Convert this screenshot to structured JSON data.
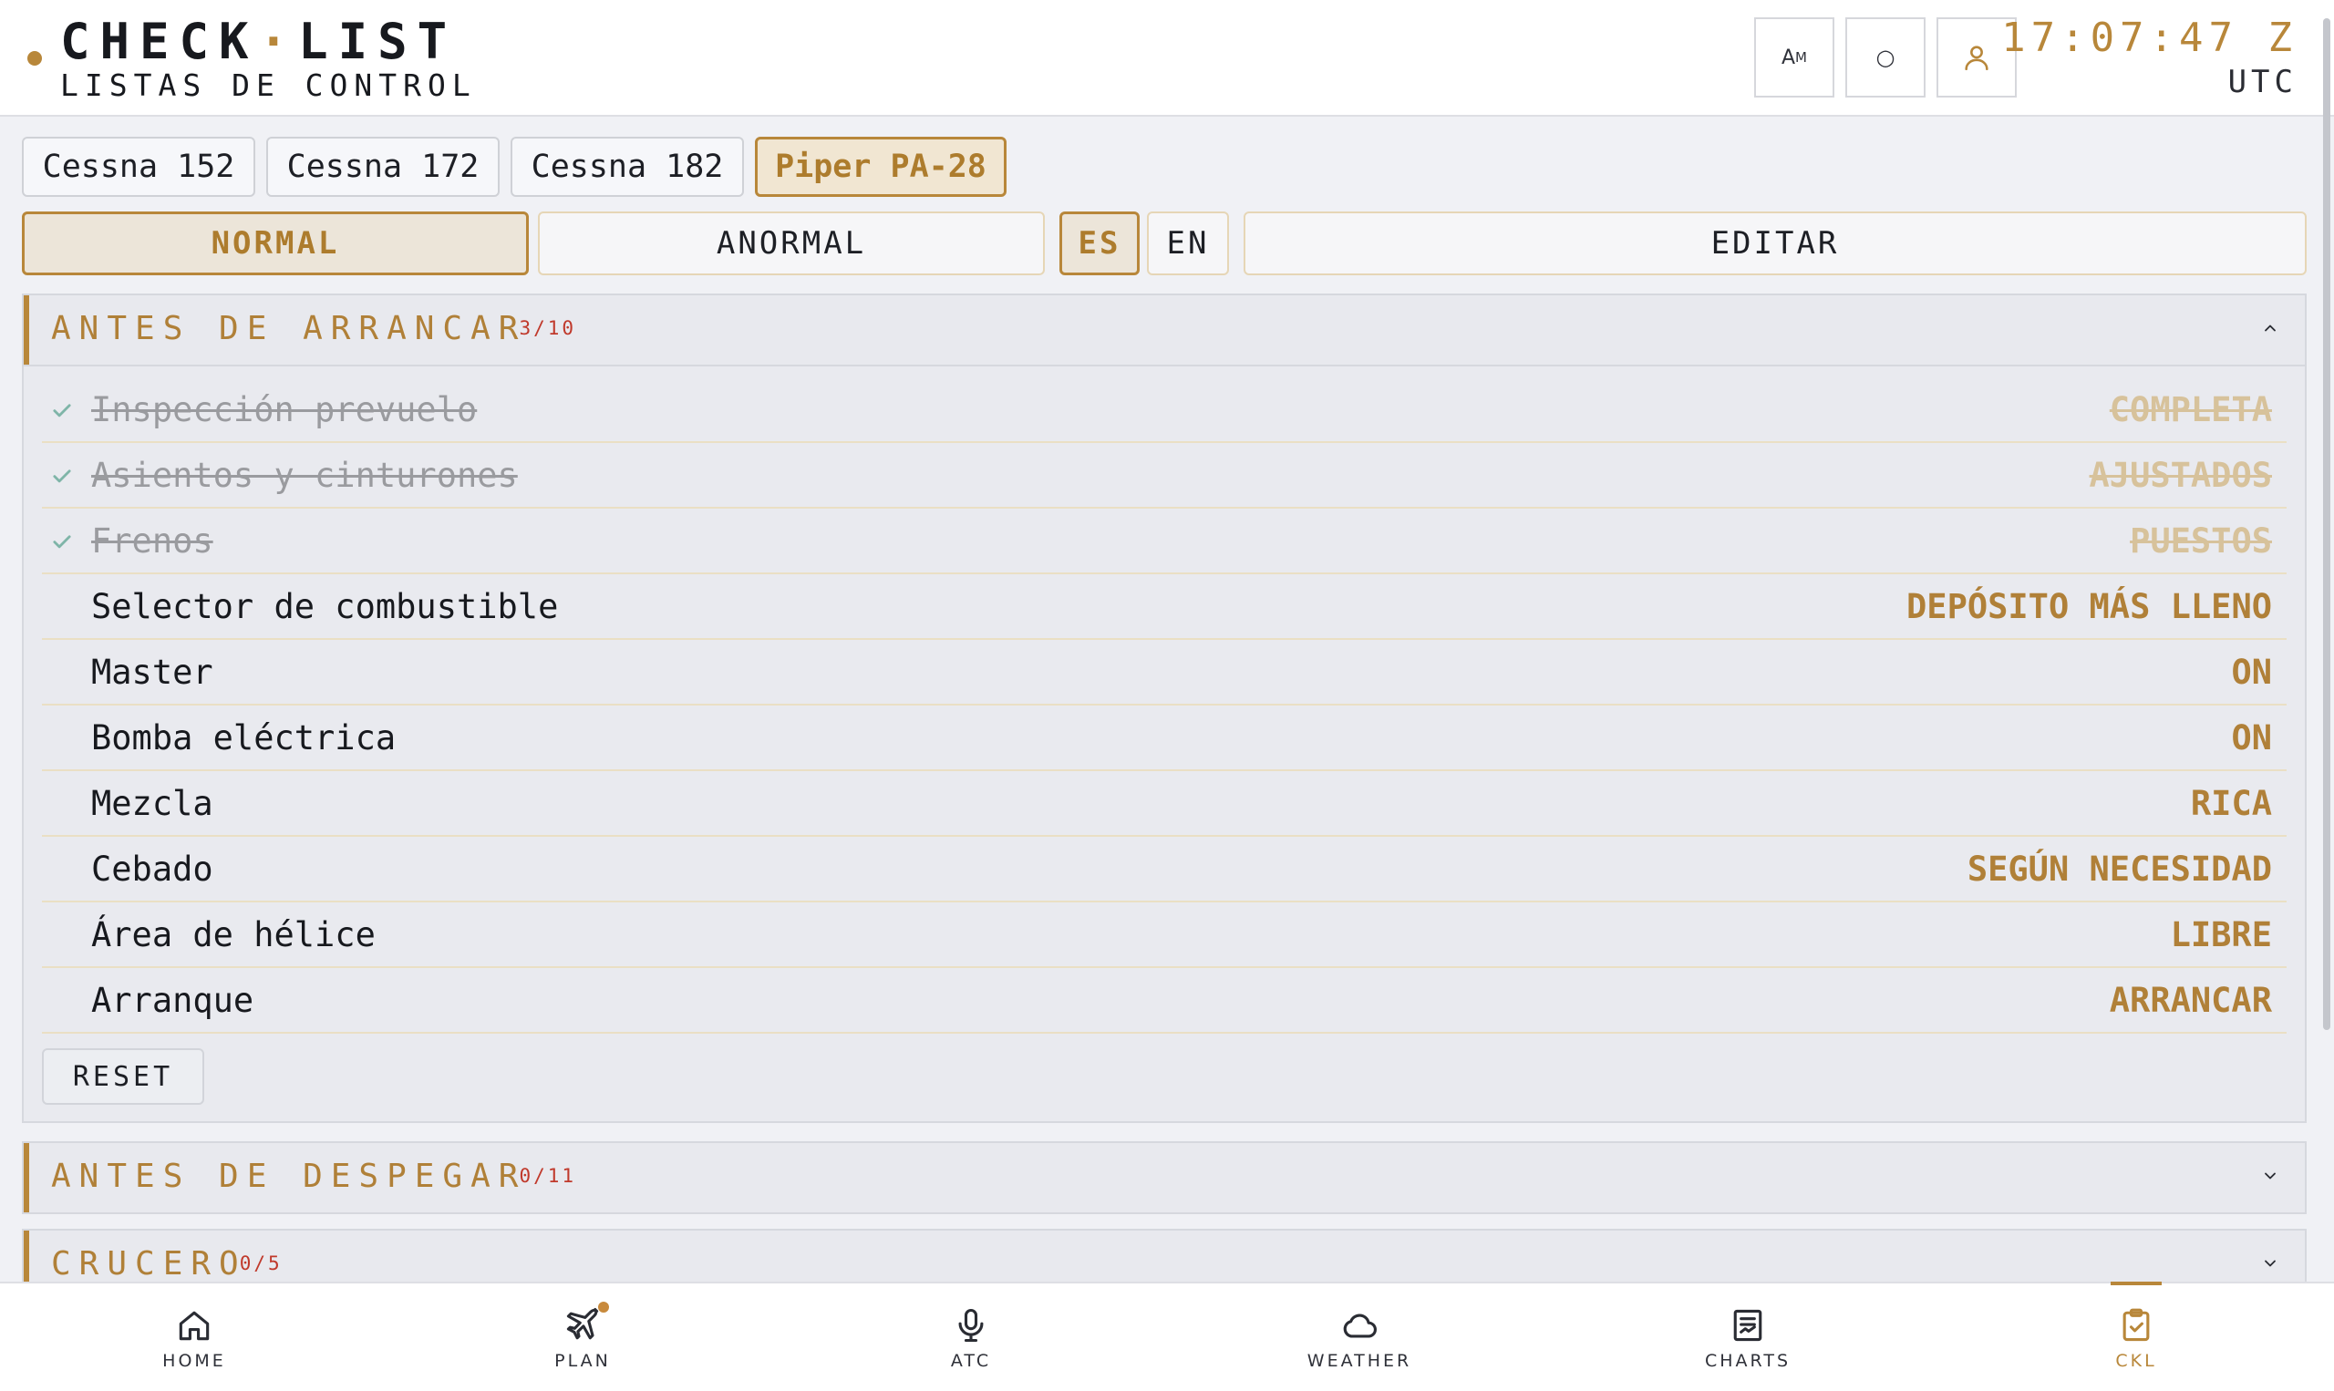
{
  "header": {
    "title_part1": "CHECK",
    "title_sep": "·",
    "title_part2": "LIST",
    "subtitle": "LISTAS DE CONTROL",
    "font_button": "A",
    "font_button_sup": "M",
    "theme_button": "○",
    "clock_time": "17:07:47 Z",
    "clock_zone": "UTC"
  },
  "aircraft_tabs": [
    {
      "label": "Cessna 152",
      "active": false
    },
    {
      "label": "Cessna 172",
      "active": false
    },
    {
      "label": "Cessna 182",
      "active": false
    },
    {
      "label": "Piper PA-28",
      "active": true
    }
  ],
  "modes": {
    "normal": "NORMAL",
    "abnormal": "ANORMAL",
    "lang_es": "ES",
    "lang_en": "EN",
    "edit": "EDITAR"
  },
  "sections": [
    {
      "title": "ANTES DE ARRANCAR",
      "count": "3/10",
      "expanded": true,
      "items": [
        {
          "label": "Inspección prevuelo",
          "value": "COMPLETA",
          "done": true
        },
        {
          "label": "Asientos y cinturones",
          "value": "AJUSTADOS",
          "done": true
        },
        {
          "label": "Frenos",
          "value": "PUESTOS",
          "done": true
        },
        {
          "label": "Selector de combustible",
          "value": "DEPÓSITO MÁS LLENO",
          "done": false
        },
        {
          "label": "Master",
          "value": "ON",
          "done": false
        },
        {
          "label": "Bomba eléctrica",
          "value": "ON",
          "done": false
        },
        {
          "label": "Mezcla",
          "value": "RICA",
          "done": false
        },
        {
          "label": "Cebado",
          "value": "SEGÚN NECESIDAD",
          "done": false
        },
        {
          "label": "Área de hélice",
          "value": "LIBRE",
          "done": false
        },
        {
          "label": "Arranque",
          "value": "ARRANCAR",
          "done": false
        }
      ],
      "reset_label": "RESET"
    },
    {
      "title": "ANTES DE DESPEGAR",
      "count": "0/11",
      "expanded": false
    },
    {
      "title": "CRUCERO",
      "count": "0/5",
      "expanded": false
    }
  ],
  "bottom_nav": [
    {
      "label": "HOME",
      "icon": "home-icon",
      "active": false
    },
    {
      "label": "PLAN",
      "icon": "plane-icon",
      "active": false
    },
    {
      "label": "ATC",
      "icon": "microphone-icon",
      "active": false
    },
    {
      "label": "WEATHER",
      "icon": "cloud-icon",
      "active": false
    },
    {
      "label": "CHARTS",
      "icon": "chart-doc-icon",
      "active": false
    },
    {
      "label": "CKL",
      "icon": "clipboard-check-icon",
      "active": true
    }
  ],
  "colors": {
    "accent": "#b8873a",
    "background": "#f0f1f5",
    "count_badge": "#c0392b",
    "done_check": "#7fb5a8"
  }
}
